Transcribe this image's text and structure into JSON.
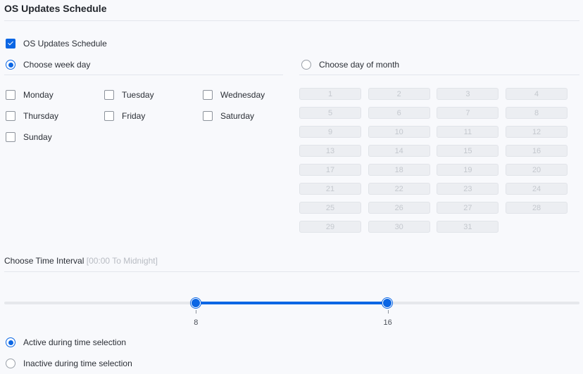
{
  "section_title": "OS Updates Schedule",
  "enable_checkbox": {
    "label": "OS Updates Schedule",
    "checked": true
  },
  "mode": {
    "week": {
      "label": "Choose week day",
      "selected": true
    },
    "month": {
      "label": "Choose day of month",
      "selected": false
    }
  },
  "weekdays": [
    "Monday",
    "Tuesday",
    "Wednesday",
    "Thursday",
    "Friday",
    "Saturday",
    "Sunday"
  ],
  "month_days": [
    "1",
    "2",
    "3",
    "4",
    "5",
    "6",
    "7",
    "8",
    "9",
    "10",
    "11",
    "12",
    "13",
    "14",
    "15",
    "16",
    "17",
    "18",
    "19",
    "20",
    "21",
    "22",
    "23",
    "24",
    "25",
    "26",
    "27",
    "28",
    "29",
    "30",
    "31"
  ],
  "time_interval": {
    "label": "Choose Time Interval",
    "hint": "[00:00 To Midnight]",
    "min": 0,
    "max": 24,
    "start": 8,
    "end": 16,
    "start_label": "8",
    "end_label": "16"
  },
  "activity": {
    "active": {
      "label": "Active during time selection",
      "selected": true
    },
    "inactive": {
      "label": "Inactive during time selection",
      "selected": false
    }
  },
  "colors": {
    "accent": "#0b66e4",
    "disabled_bg": "#eceef2",
    "disabled_text": "#c4c8ce"
  }
}
